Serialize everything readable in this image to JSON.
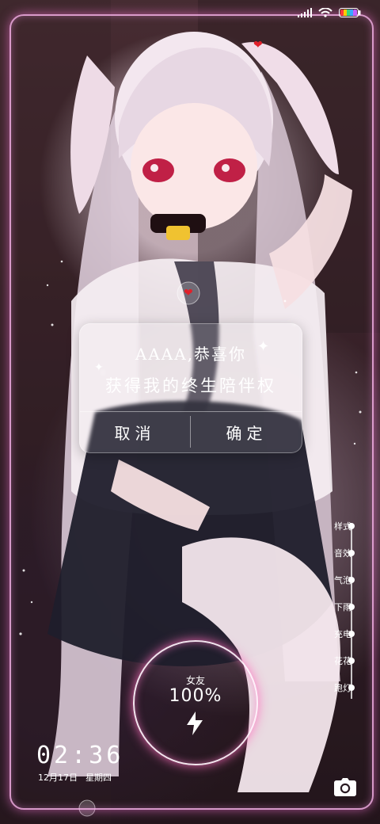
{
  "dialog": {
    "line1": "AAAA,恭喜你",
    "line2": "获得我的终生陪伴权",
    "cancel_label": "取消",
    "ok_label": "确定"
  },
  "side_menu": {
    "items": [
      {
        "label": "样式"
      },
      {
        "label": "音效"
      },
      {
        "label": "气泡"
      },
      {
        "label": "下雨"
      },
      {
        "label": "充电"
      },
      {
        "label": "花花"
      },
      {
        "label": "跑灯"
      }
    ]
  },
  "charging": {
    "label": "女友",
    "percent_text": "100%",
    "level": 1.0
  },
  "clock": {
    "time": "02:36",
    "date": "12月17日",
    "weekday": "星期四"
  },
  "status_bar": {
    "icons": [
      "signal-icon",
      "wifi-icon",
      "battery-icon"
    ]
  },
  "colors": {
    "frame_glow": "#f5afe6",
    "text": "#ffffff",
    "accent_red": "#e0202a"
  }
}
